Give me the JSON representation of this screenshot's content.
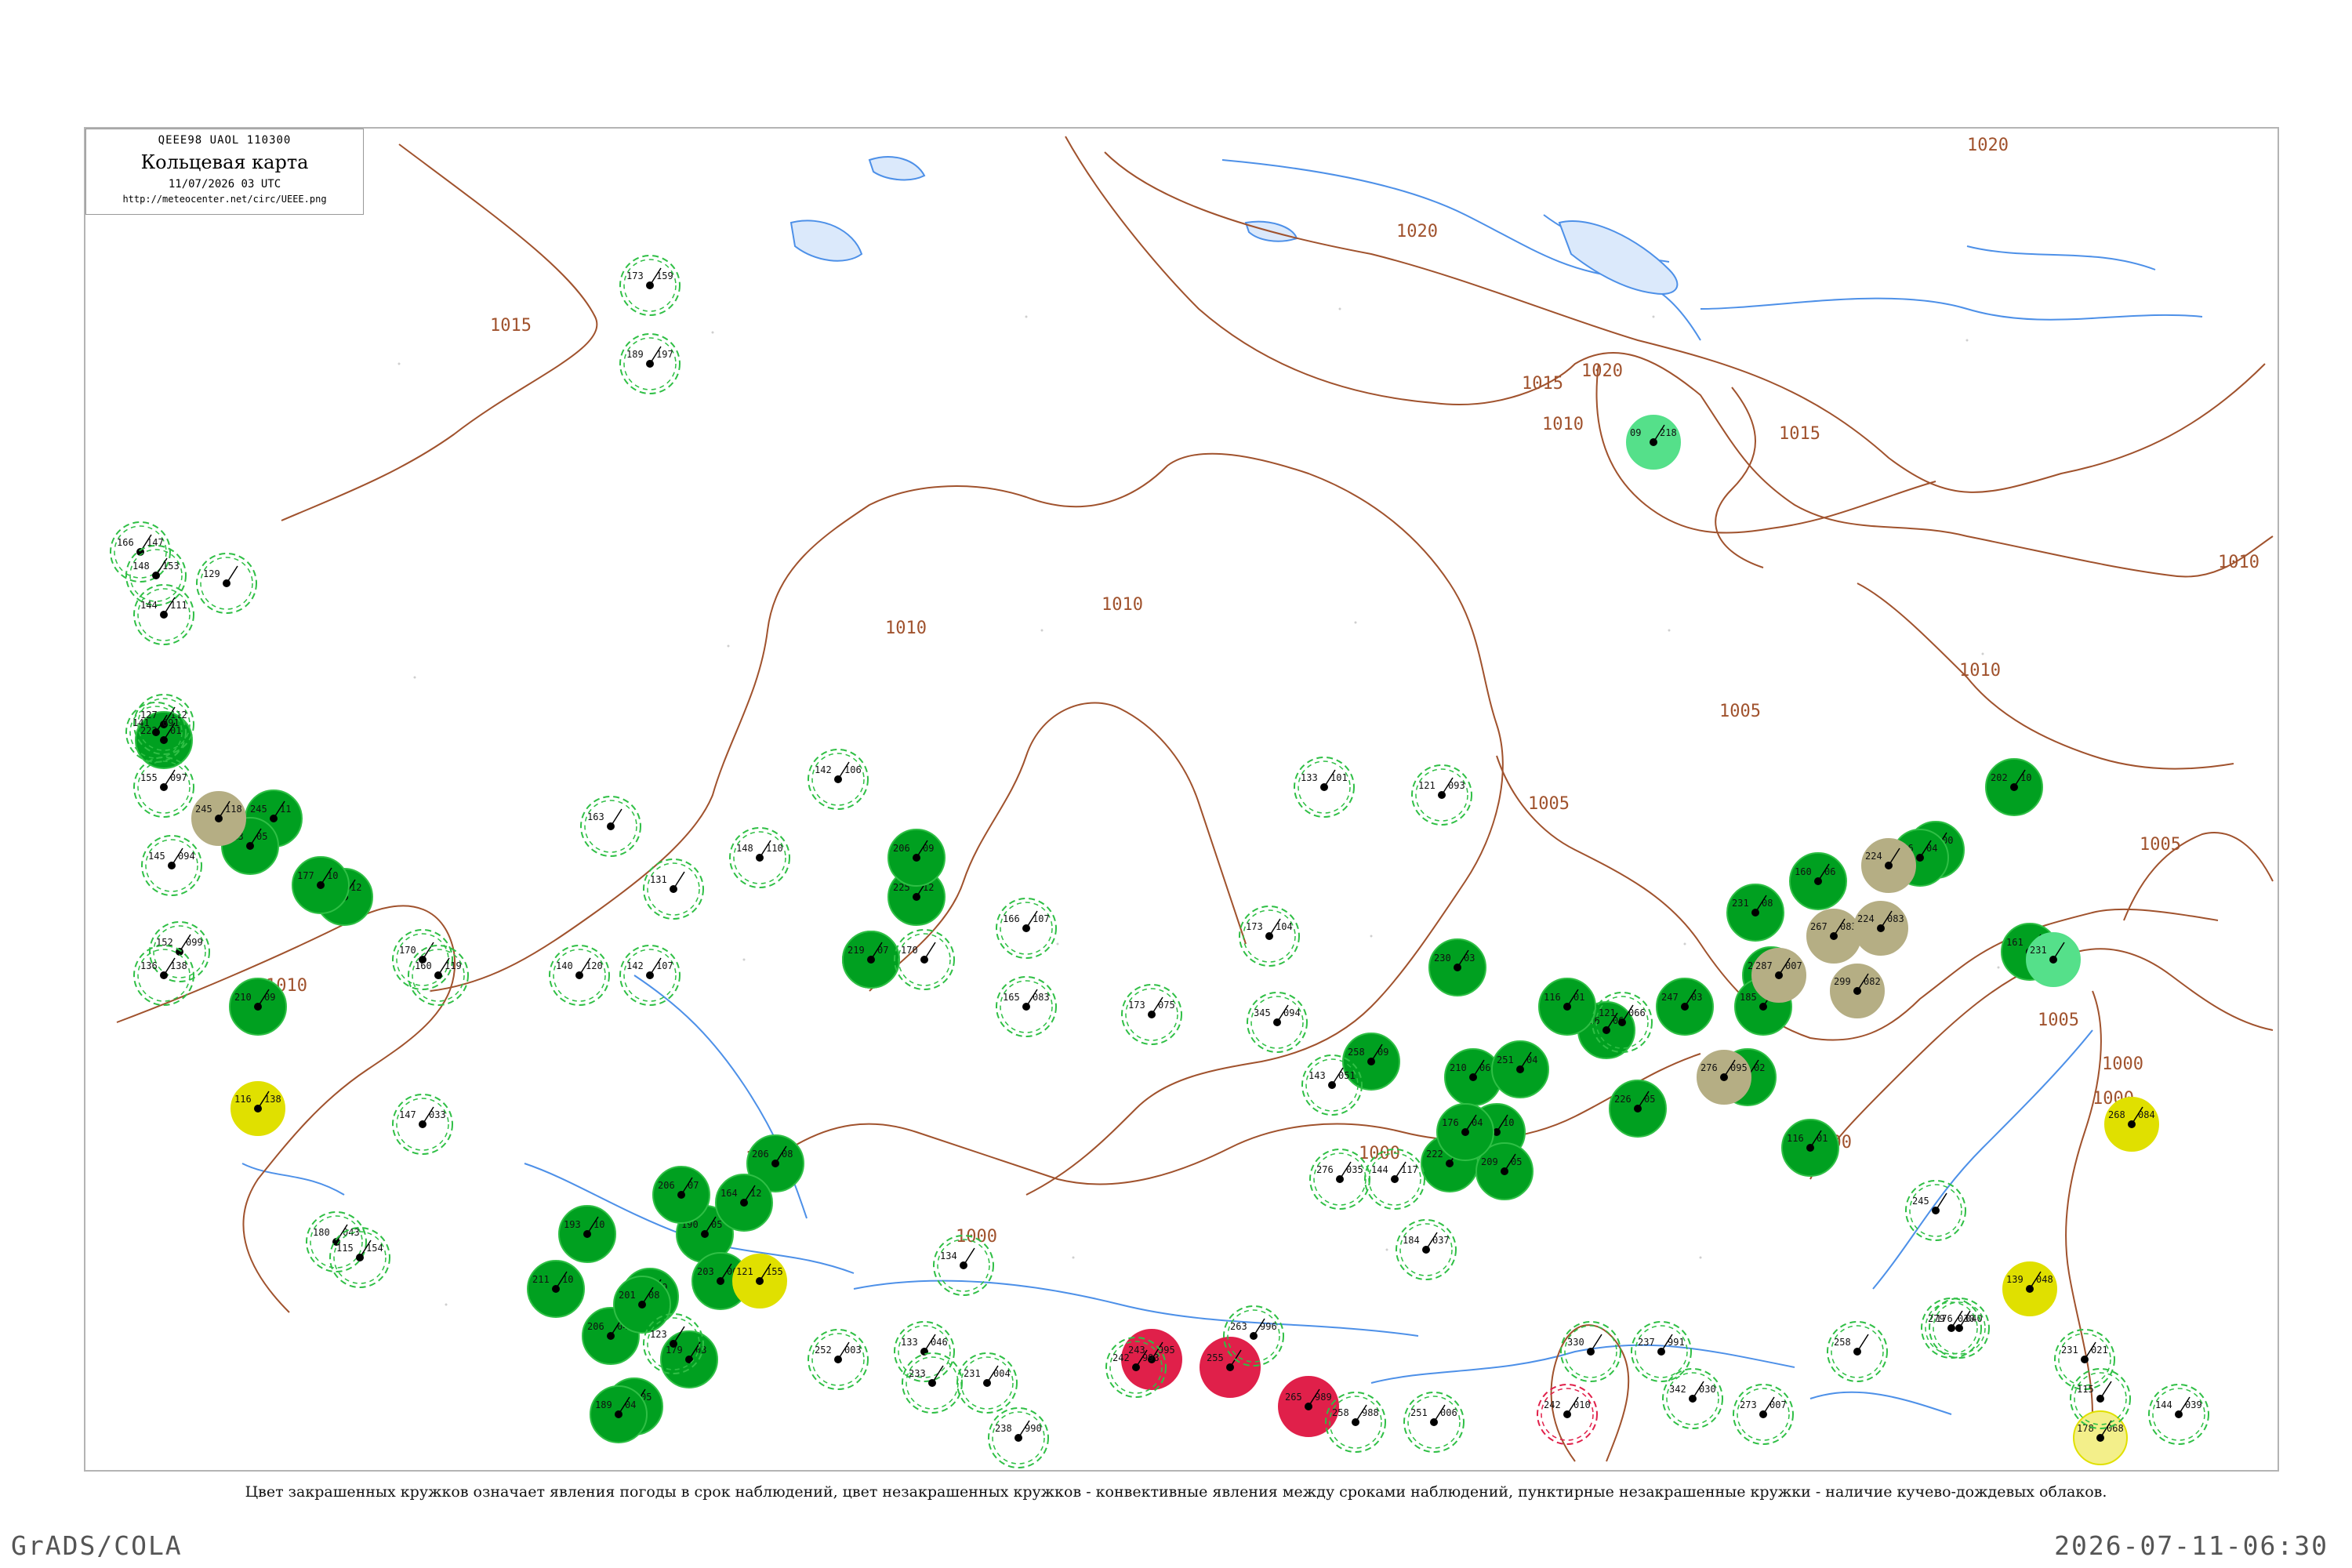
{
  "header": {
    "codes": "QEEE98  UAOL  110300",
    "title": "Кольцевая карта",
    "datetime": "11/07/2026 03 UTC",
    "url": "http://meteocenter.net/circ/UEEE.png"
  },
  "caption": "Цвет закрашенных кружков означает явления погоды в срок наблюдений, цвет незакрашенных кружков - конвективные явления между сроками наблюдений, пунктирные незакрашенные кружки - наличие кучево-дождевых облаков.",
  "footer": {
    "left": "GrADS/COLA",
    "right": "2026-07-11-06:30"
  },
  "colors": {
    "isobar": "#a0522d",
    "river": "#4d90e8",
    "lake_fill": "#dbe9fb",
    "shower": "#00a020",
    "storm": "#e0e000",
    "haze": "#b5ae84",
    "heavy": "#e0204a",
    "light": "#55e08a",
    "dashed_ring": "#2fbf45"
  },
  "isobar_labels": [
    "1020",
    "1020",
    "1020",
    "1015",
    "1015",
    "1015",
    "1010",
    "1010",
    "1010",
    "1010",
    "1010",
    "1010",
    "1005",
    "1005",
    "1005",
    "1005",
    "1005",
    "1000",
    "1000",
    "1000",
    "1000",
    "1000"
  ],
  "stations": [
    {
      "kind": "shower",
      "t": "222",
      "p": "01",
      "id": ""
    },
    {
      "kind": "shower",
      "t": "245",
      "p": "11",
      "id": ""
    },
    {
      "kind": "shower",
      "t": "213",
      "p": "05",
      "id": ""
    },
    {
      "kind": "shower",
      "t": "173",
      "p": "12",
      "id": ""
    },
    {
      "kind": "shower",
      "t": "177",
      "p": "10",
      "id": ""
    },
    {
      "kind": "shower",
      "t": "210",
      "p": "09",
      "id": ""
    },
    {
      "kind": "shower",
      "t": "225",
      "p": "12",
      "id": ""
    },
    {
      "kind": "shower",
      "t": "213",
      "p": "06",
      "id": ""
    },
    {
      "kind": "shower",
      "t": "219",
      "p": "07",
      "id": ""
    },
    {
      "kind": "shower",
      "t": "206",
      "p": "08",
      "id": ""
    },
    {
      "kind": "shower",
      "t": "190",
      "p": "05",
      "id": ""
    },
    {
      "kind": "shower",
      "t": "206",
      "p": "07",
      "id": ""
    },
    {
      "kind": "shower",
      "t": "213",
      "p": "09",
      "id": ""
    },
    {
      "kind": "shower",
      "t": "206",
      "p": "04",
      "id": ""
    },
    {
      "kind": "shower",
      "t": "211",
      "p": "10",
      "id": ""
    },
    {
      "kind": "shower",
      "t": "203",
      "p": "06",
      "id": ""
    },
    {
      "kind": "shower",
      "t": "179",
      "p": "03",
      "id": ""
    },
    {
      "kind": "shower",
      "t": "167",
      "p": "05",
      "id": ""
    },
    {
      "kind": "shower",
      "t": "201",
      "p": "08",
      "id": ""
    },
    {
      "kind": "shower",
      "t": "193",
      "p": "10",
      "id": ""
    },
    {
      "kind": "shower",
      "t": "206",
      "p": "09",
      "id": ""
    },
    {
      "kind": "shower",
      "t": "164",
      "p": "12",
      "id": ""
    },
    {
      "kind": "shower",
      "t": "189",
      "p": "04",
      "id": ""
    },
    {
      "kind": "shower",
      "t": "230",
      "p": "03",
      "id": ""
    },
    {
      "kind": "shower",
      "t": "210",
      "p": "06",
      "id": ""
    },
    {
      "kind": "shower",
      "t": "201",
      "p": "07",
      "id": ""
    },
    {
      "kind": "shower",
      "t": "215",
      "p": "10",
      "id": ""
    },
    {
      "kind": "shower",
      "t": "222",
      "p": "08",
      "id": ""
    },
    {
      "kind": "shower",
      "t": "209",
      "p": "05",
      "id": ""
    },
    {
      "kind": "shower",
      "t": "176",
      "p": "04",
      "id": ""
    },
    {
      "kind": "shower",
      "t": "251",
      "p": "04",
      "id": ""
    },
    {
      "kind": "shower",
      "t": "258",
      "p": "09",
      "id": ""
    },
    {
      "kind": "shower",
      "t": "226",
      "p": "06",
      "id": ""
    },
    {
      "kind": "shower",
      "t": "247",
      "p": "03",
      "id": ""
    },
    {
      "kind": "shower",
      "t": "231",
      "p": "08",
      "id": ""
    },
    {
      "kind": "shower",
      "t": "224",
      "p": "06",
      "id": ""
    },
    {
      "kind": "shower",
      "t": "202",
      "p": "10",
      "id": ""
    },
    {
      "kind": "shower",
      "t": "155",
      "p": "00",
      "id": ""
    },
    {
      "kind": "shower",
      "t": "146",
      "p": "04",
      "id": ""
    },
    {
      "kind": "shower",
      "t": "161",
      "p": "02",
      "id": ""
    },
    {
      "kind": "shower",
      "t": "160",
      "p": "06",
      "id": ""
    },
    {
      "kind": "shower",
      "t": "161",
      "p": "02",
      "id": ""
    },
    {
      "kind": "shower",
      "t": "116",
      "p": "01",
      "id": ""
    },
    {
      "kind": "shower",
      "t": "226",
      "p": "05",
      "id": ""
    },
    {
      "kind": "shower",
      "t": "185",
      "p": "10",
      "id": ""
    },
    {
      "kind": "shower",
      "t": "116",
      "p": "01",
      "id": ""
    },
    {
      "kind": "storm",
      "t": "116",
      "p": "138",
      "id": ""
    },
    {
      "kind": "storm",
      "t": "121",
      "p": "155",
      "id": ""
    },
    {
      "kind": "storm",
      "t": "268",
      "p": "084",
      "id": ""
    },
    {
      "kind": "storm",
      "t": "139",
      "p": "048",
      "id": ""
    },
    {
      "kind": "storm",
      "t": "178",
      "p": "068",
      "id": "",
      "pale": true
    },
    {
      "kind": "haze",
      "t": "245",
      "p": "118",
      "id": ""
    },
    {
      "kind": "haze",
      "t": "267",
      "p": "083",
      "id": ""
    },
    {
      "kind": "haze",
      "t": "299",
      "p": "082",
      "id": ""
    },
    {
      "kind": "haze",
      "t": "276",
      "p": "095",
      "id": ""
    },
    {
      "kind": "haze",
      "t": "287",
      "p": "007",
      "id": ""
    },
    {
      "kind": "haze",
      "t": "224",
      "p": "",
      "id": ""
    },
    {
      "kind": "haze",
      "t": "224",
      "p": "083",
      "id": ""
    },
    {
      "kind": "heavy",
      "t": "243",
      "p": "995",
      "id": ""
    },
    {
      "kind": "heavy",
      "t": "255",
      "p": "",
      "id": ""
    },
    {
      "kind": "heavy",
      "t": "265",
      "p": "989",
      "id": ""
    },
    {
      "kind": "light",
      "t": "09",
      "p": "218",
      "id": ""
    },
    {
      "kind": "light",
      "t": "231",
      "p": "",
      "id": ""
    },
    {
      "kind": "dashed",
      "t": "173",
      "p": "159",
      "id": ""
    },
    {
      "kind": "dashed",
      "t": "189",
      "p": "197",
      "id": ""
    },
    {
      "kind": "dashed",
      "t": "166",
      "p": "147",
      "id": ""
    },
    {
      "kind": "dashed",
      "t": "148",
      "p": "153",
      "id": ""
    },
    {
      "kind": "dashed",
      "t": "129",
      "p": "",
      "id": ""
    },
    {
      "kind": "dashed",
      "t": "144",
      "p": "111",
      "id": ""
    },
    {
      "kind": "dashed",
      "t": "127",
      "p": "112",
      "id": ""
    },
    {
      "kind": "dashed",
      "t": "141",
      "p": "091",
      "id": ""
    },
    {
      "kind": "dashed",
      "t": "155",
      "p": "097",
      "id": ""
    },
    {
      "kind": "dashed",
      "t": "145",
      "p": "094",
      "id": ""
    },
    {
      "kind": "dashed",
      "t": "152",
      "p": "099",
      "id": ""
    },
    {
      "kind": "dashed",
      "t": "136",
      "p": "138",
      "id": ""
    },
    {
      "kind": "dashed",
      "t": "170",
      "p": "",
      "id": ""
    },
    {
      "kind": "dashed",
      "t": "160",
      "p": "119",
      "id": ""
    },
    {
      "kind": "dashed",
      "t": "140",
      "p": "120",
      "id": ""
    },
    {
      "kind": "dashed",
      "t": "142",
      "p": "107",
      "id": ""
    },
    {
      "kind": "dashed",
      "t": "173",
      "p": "104",
      "id": ""
    },
    {
      "kind": "dashed",
      "t": "131",
      "p": "",
      "id": ""
    },
    {
      "kind": "dashed",
      "t": "163",
      "p": "",
      "id": ""
    },
    {
      "kind": "dashed",
      "t": "148",
      "p": "110",
      "id": ""
    },
    {
      "kind": "dashed",
      "t": "142",
      "p": "106",
      "id": ""
    },
    {
      "kind": "dashed",
      "t": "170",
      "p": "",
      "id": ""
    },
    {
      "kind": "dashed",
      "t": "166",
      "p": "107",
      "id": ""
    },
    {
      "kind": "dashed",
      "t": "165",
      "p": "083",
      "id": ""
    },
    {
      "kind": "dashed",
      "t": "173",
      "p": "075",
      "id": ""
    },
    {
      "kind": "dashed",
      "t": "345",
      "p": "094",
      "id": ""
    },
    {
      "kind": "dashed",
      "t": "133",
      "p": "101",
      "id": ""
    },
    {
      "kind": "dashed",
      "t": "121",
      "p": "093",
      "id": ""
    },
    {
      "kind": "dashed",
      "t": "121",
      "p": "066",
      "id": ""
    },
    {
      "kind": "dashed",
      "t": "143",
      "p": "051",
      "id": ""
    },
    {
      "kind": "dashed",
      "t": "276",
      "p": "035",
      "id": ""
    },
    {
      "kind": "dashed",
      "t": "144",
      "p": "117",
      "id": ""
    },
    {
      "kind": "dashed",
      "t": "184",
      "p": "037",
      "id": ""
    },
    {
      "kind": "dashed",
      "t": "147",
      "p": "033",
      "id": ""
    },
    {
      "kind": "dashed",
      "t": "180",
      "p": "043",
      "id": ""
    },
    {
      "kind": "dashed",
      "t": "115",
      "p": "154",
      "id": ""
    },
    {
      "kind": "dashed",
      "t": "123",
      "p": "",
      "id": ""
    },
    {
      "kind": "dashed",
      "t": "134",
      "p": "",
      "id": ""
    },
    {
      "kind": "dashed",
      "t": "133",
      "p": "046",
      "id": ""
    },
    {
      "kind": "dashed",
      "t": "252",
      "p": "003",
      "id": ""
    },
    {
      "kind": "dashed",
      "t": "231",
      "p": "004",
      "id": ""
    },
    {
      "kind": "dashed",
      "t": "233",
      "p": "",
      "id": ""
    },
    {
      "kind": "dashed",
      "t": "263",
      "p": "996",
      "id": ""
    },
    {
      "kind": "dashed",
      "t": "238",
      "p": "990",
      "id": ""
    },
    {
      "kind": "dashed",
      "t": "242",
      "p": "993",
      "id": ""
    },
    {
      "kind": "dashed",
      "t": "258",
      "p": "988",
      "id": ""
    },
    {
      "kind": "dashed",
      "t": "251",
      "p": "006",
      "id": ""
    },
    {
      "kind": "dashed",
      "t": "237",
      "p": "991",
      "id": ""
    },
    {
      "kind": "dashed",
      "t": "245",
      "p": "",
      "id": ""
    },
    {
      "kind": "dashed",
      "t": "330",
      "p": "",
      "id": ""
    },
    {
      "kind": "dashed",
      "t": "242",
      "p": "010",
      "id": "",
      "redring": true
    },
    {
      "kind": "dashed",
      "t": "342",
      "p": "030",
      "id": ""
    },
    {
      "kind": "dashed",
      "t": "273",
      "p": "007",
      "id": ""
    },
    {
      "kind": "dashed",
      "t": "258",
      "p": "",
      "id": ""
    },
    {
      "kind": "dashed",
      "t": "176",
      "p": "040",
      "id": ""
    },
    {
      "kind": "dashed",
      "t": "231",
      "p": "021",
      "id": ""
    },
    {
      "kind": "dashed",
      "t": "279",
      "p": "030",
      "id": ""
    },
    {
      "kind": "dashed",
      "t": "144",
      "p": "039",
      "id": ""
    },
    {
      "kind": "dashed",
      "t": "115",
      "p": "",
      "id": ""
    }
  ]
}
